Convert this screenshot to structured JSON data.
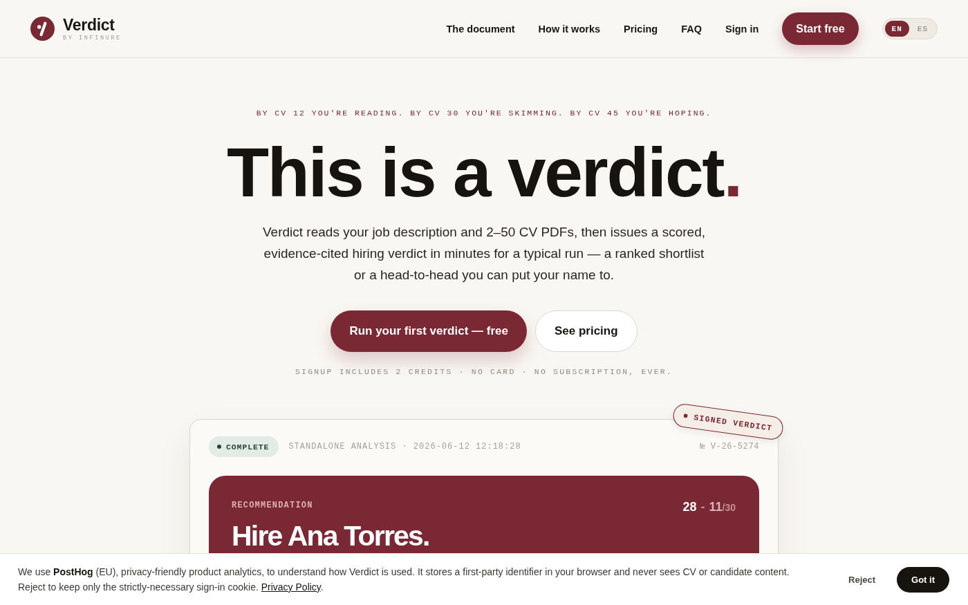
{
  "header": {
    "brand": {
      "name": "Verdict",
      "byline": "BY INFINURE"
    },
    "nav": [
      {
        "label": "The document"
      },
      {
        "label": "How it works"
      },
      {
        "label": "Pricing"
      },
      {
        "label": "FAQ"
      },
      {
        "label": "Sign in"
      }
    ],
    "cta": "Start free",
    "languages": [
      {
        "label": "EN",
        "selected": true
      },
      {
        "label": "ES",
        "selected": false
      }
    ]
  },
  "hero": {
    "eyebrow": "BY CV 12 YOU'RE READING. BY CV 30 YOU'RE SKIMMING. BY CV 45 YOU'RE HOPING.",
    "headline": {
      "text": "This is a verdict",
      "accent": "."
    },
    "description": "Verdict reads your job description and 2–50 CV PDFs, then issues a scored, evidence-cited hiring verdict in minutes for a typical run — a ranked shortlist or a head-to-head you can put your name to.",
    "buttons": [
      {
        "label": "Run your first verdict — free",
        "kind": "primary"
      },
      {
        "label": "See pricing",
        "kind": "secondary"
      }
    ],
    "note": "SIGNUP INCLUDES 2 CREDITS · NO CARD · NO SUBSCRIPTION, EVER."
  },
  "verdict_card": {
    "stamp": "SIGNED VERDICT",
    "status": {
      "label": "COMPLETE",
      "kind": "complete"
    },
    "meta": "STANDALONE ANALYSIS · 2026-06-12 12:18:28",
    "reference": "№ V-26-5274",
    "recommendation": {
      "label": "RECOMMENDATION",
      "title": "Hire Ana Torres.",
      "score": {
        "primary": "28",
        "separator": "-",
        "secondary": "11",
        "max": "/30"
      }
    }
  },
  "cookie_banner": {
    "text": "We use **PostHog** (EU), privacy-friendly product analytics, to understand how Verdict is used. It stores a first-party identifier in your browser and never sees CV or candidate content. Reject to keep only the strictly-necessary sign-in cookie.",
    "link": "Privacy Policy",
    "after_link": ".",
    "buttons": [
      {
        "label": "Reject",
        "kind": "text"
      },
      {
        "label": "Got it",
        "kind": "solid"
      }
    ]
  }
}
